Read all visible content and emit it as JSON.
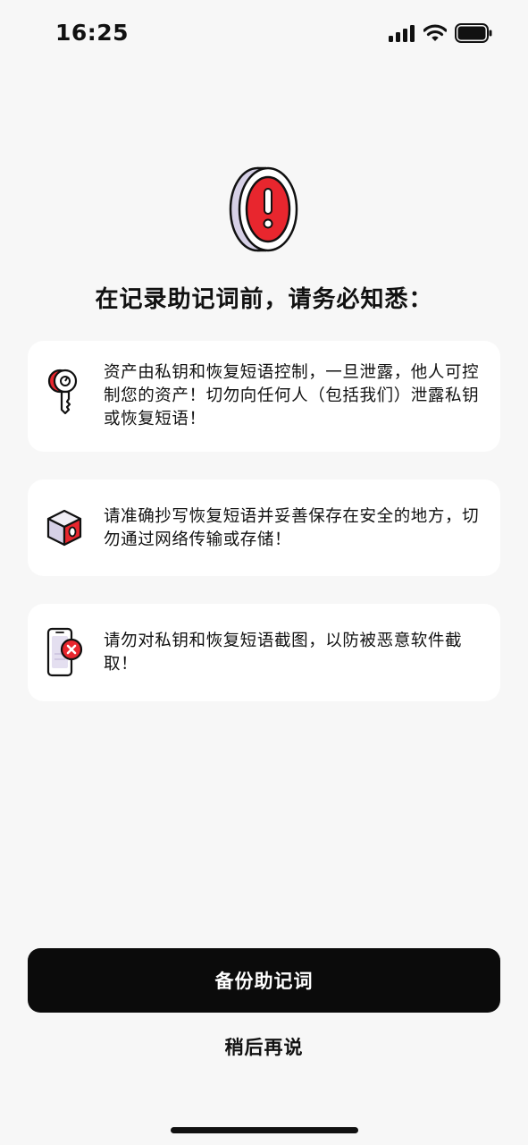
{
  "status_bar": {
    "time": "16:25"
  },
  "hero": {
    "icon": "warning-coin-icon"
  },
  "title": "在记录助记词前，请务必知悉：",
  "tips": [
    {
      "icon": "key-icon",
      "text": "资产由私钥和恢复短语控制，一旦泄露，他人可控制您的资产！切勿向任何人（包括我们）泄露私钥或恢复短语！"
    },
    {
      "icon": "safe-box-icon",
      "text": "请准确抄写恢复短语并妥善保存在安全的地方，切勿通过网络传输或存储！"
    },
    {
      "icon": "no-screenshot-icon",
      "text": "请勿对私钥和恢复短语截图，以防被恶意软件截取！"
    }
  ],
  "actions": {
    "primary_label": "备份助记词",
    "secondary_label": "稍后再说"
  },
  "colors": {
    "accent_red": "#e8262e",
    "button_bg": "#0b0b0b",
    "card_bg": "#ffffff",
    "page_bg": "#f7f7f7"
  }
}
